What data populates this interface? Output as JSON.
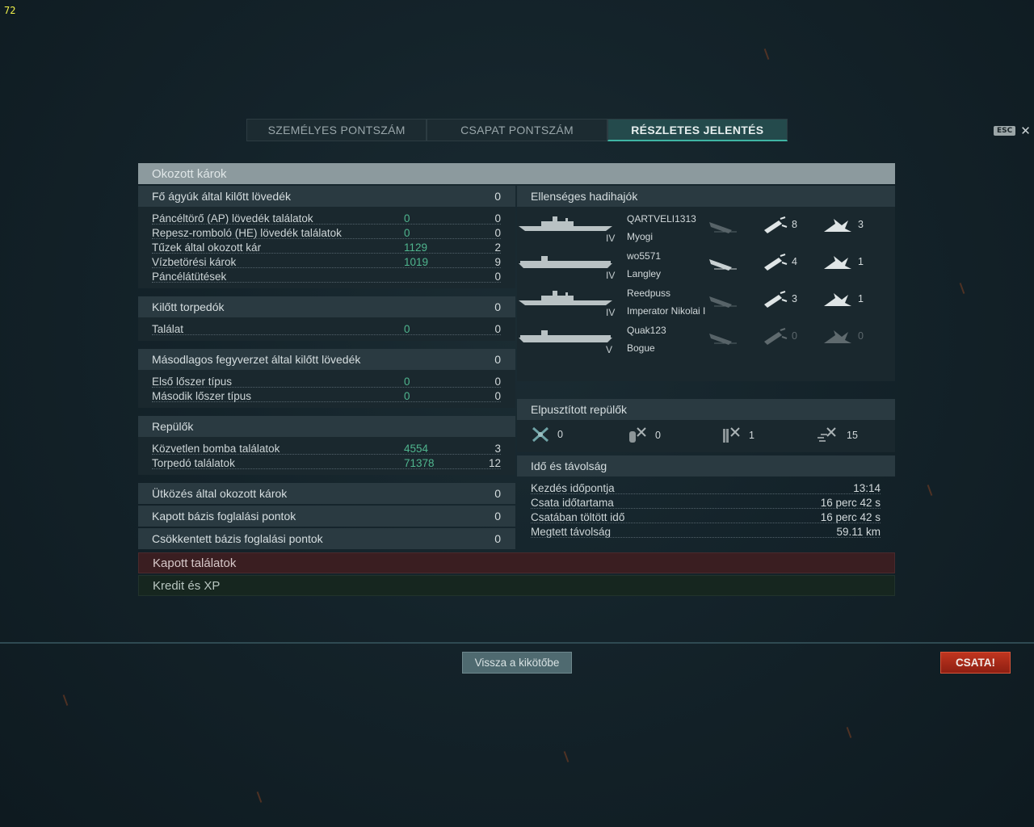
{
  "fps": "72",
  "tabs": [
    "SZEMÉLYES PONTSZÁM",
    "CSAPAT PONTSZÁM",
    "RÉSZLETES JELENTÉS"
  ],
  "esc_label": "ESC",
  "report": {
    "title": "Okozott károk",
    "main_guns": {
      "title": "Fő ágyúk által kilőtt lövedék",
      "total": "0",
      "rows": [
        {
          "label": "Páncéltörő (AP) lövedék találatok",
          "damage": "0",
          "hits": "0"
        },
        {
          "label": "Repesz-romboló (HE) lövedék találatok",
          "damage": "0",
          "hits": "0"
        },
        {
          "label": "Tűzek által okozott kár",
          "damage": "1129",
          "hits": "2"
        },
        {
          "label": "Vízbetörési károk",
          "damage": "1019",
          "hits": "9"
        },
        {
          "label": "Páncélátütések",
          "damage": "",
          "hits": "0"
        }
      ]
    },
    "torpedoes": {
      "title": "Kilőtt torpedók",
      "total": "0",
      "rows": [
        {
          "label": "Találat",
          "damage": "0",
          "hits": "0"
        }
      ]
    },
    "secondary": {
      "title": "Másodlagos fegyverzet által kilőtt lövedék",
      "total": "0",
      "rows": [
        {
          "label": "Első lőszer típus",
          "damage": "0",
          "hits": "0"
        },
        {
          "label": "Második lőszer típus",
          "damage": "0",
          "hits": "0"
        }
      ]
    },
    "aircraft": {
      "title": "Repülők",
      "total": "",
      "rows": [
        {
          "label": "Közvetlen bomba találatok",
          "damage": "4554",
          "hits": "3"
        },
        {
          "label": "Torpedó találatok",
          "damage": "71378",
          "hits": "12"
        }
      ]
    },
    "ramming": {
      "title": "Ütközés által okozott károk",
      "total": "0"
    },
    "base_capture": {
      "title": "Kapott bázis foglalási pontok",
      "total": "0"
    },
    "base_reduce": {
      "title": "Csökkentett bázis foglalási pontok",
      "total": "0"
    },
    "enemy_ships": {
      "title": "Ellenséges hadihajók",
      "ships": [
        {
          "player": "QARTVELI1313",
          "ship": "Myogi",
          "tier": "IV",
          "hits_a": "8",
          "hits_b": "3",
          "type": "battleship"
        },
        {
          "player": "wo5571",
          "ship": "Langley",
          "tier": "IV",
          "hits_a": "4",
          "hits_b": "1",
          "type": "carrier"
        },
        {
          "player": "Reedpuss",
          "ship": "Imperator Nikolai I",
          "tier": "IV",
          "hits_a": "3",
          "hits_b": "1",
          "type": "battleship"
        },
        {
          "player": "Quak123",
          "ship": "Bogue",
          "tier": "V",
          "hits_a": "0",
          "hits_b": "0",
          "type": "carrier"
        }
      ]
    },
    "planes": {
      "title": "Elpusztított repülők",
      "items": [
        {
          "icon": "fighter-icon",
          "count": "0"
        },
        {
          "icon": "dive-bomber-icon",
          "count": "0"
        },
        {
          "icon": "torpedo-bomber-icon",
          "count": "1"
        },
        {
          "icon": "squadron-icon",
          "count": "15"
        }
      ]
    },
    "time": {
      "title": "Idő és távolság",
      "rows": [
        {
          "label": "Kezdés időpontja",
          "value": "13:14"
        },
        {
          "label": "Csata időtartama",
          "value": "16 perc 42 s"
        },
        {
          "label": "Csatában töltött idő",
          "value": "16 perc 42 s"
        },
        {
          "label": "Megtett távolság",
          "value": "59.11 km"
        }
      ]
    }
  },
  "received_hits": "Kapott találatok",
  "credits_xp": "Kredit és XP",
  "back_button": "Vissza a kikötőbe",
  "battle_button": "CSATA!",
  "colors": {
    "accent": "#3fb5a4",
    "damage_value": "#4fb58e",
    "battle": "#c0351f"
  }
}
